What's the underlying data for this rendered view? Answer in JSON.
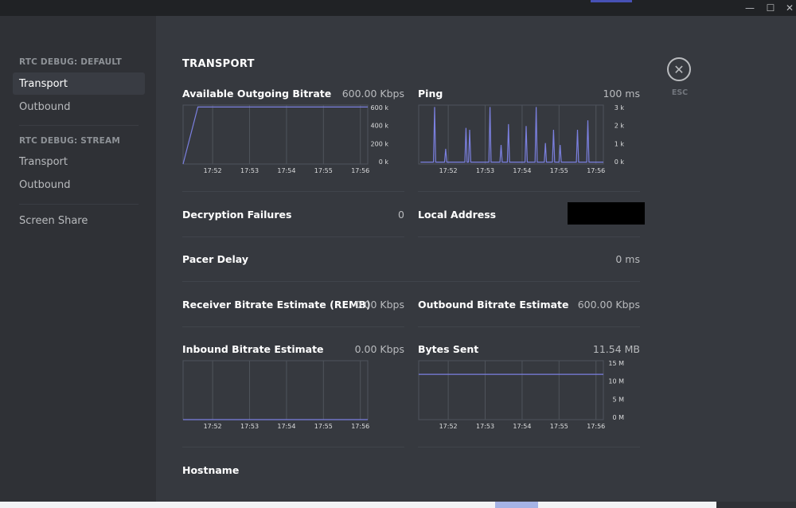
{
  "window_controls": {
    "minimize": "—",
    "maximize": "☐",
    "close": "✕"
  },
  "sidebar": {
    "sections": [
      {
        "header": "RTC DEBUG: DEFAULT",
        "items": [
          {
            "label": "Transport",
            "selected": true
          },
          {
            "label": "Outbound",
            "selected": false
          }
        ]
      },
      {
        "header": "RTC DEBUG: STREAM",
        "items": [
          {
            "label": "Transport",
            "selected": false
          },
          {
            "label": "Outbound",
            "selected": false
          }
        ]
      },
      {
        "header": "",
        "items": [
          {
            "label": "Screen Share",
            "selected": false
          }
        ]
      }
    ]
  },
  "main": {
    "title": "TRANSPORT",
    "close": {
      "icon": "close-icon",
      "glyph": "✕",
      "label": "ESC"
    },
    "metrics": {
      "available_outgoing_bitrate": {
        "label": "Available Outgoing Bitrate",
        "value": "600.00 Kbps"
      },
      "ping": {
        "label": "Ping",
        "value": "100 ms"
      },
      "decryption_failures": {
        "label": "Decryption Failures",
        "value": "0"
      },
      "local_address": {
        "label": "Local Address",
        "value": ""
      },
      "pacer_delay": {
        "label": "Pacer Delay",
        "value": "0 ms"
      },
      "receiver_bitrate_estimate": {
        "label": "Receiver Bitrate Estimate (REMB)",
        "value": "0.00 Kbps"
      },
      "outbound_bitrate_estimate": {
        "label": "Outbound Bitrate Estimate",
        "value": "600.00 Kbps"
      },
      "inbound_bitrate_estimate": {
        "label": "Inbound Bitrate Estimate",
        "value": "0.00 Kbps"
      },
      "bytes_sent": {
        "label": "Bytes Sent",
        "value": "11.54 MB"
      },
      "hostname": {
        "label": "Hostname",
        "value": ""
      }
    }
  },
  "chart_data": [
    {
      "type": "line",
      "x_ticks": [
        "17:52",
        "17:53",
        "17:54",
        "17:55",
        "17:56"
      ],
      "y_ticks": [
        "600 k",
        "400 k",
        "200 k",
        "0 k"
      ],
      "ylim": [
        0,
        620
      ],
      "x": [
        0,
        0.4,
        1,
        5
      ],
      "values": [
        0,
        600,
        600,
        600
      ]
    },
    {
      "type": "line",
      "x_ticks": [
        "17:52",
        "17:53",
        "17:54",
        "17:55",
        "17:56"
      ],
      "y_ticks": [
        "3 k",
        "2 k",
        "1 k",
        "0 k"
      ],
      "ylim": [
        0,
        3100
      ],
      "x": [
        0.05,
        0.1,
        0.4,
        0.43,
        0.46,
        0.7,
        0.73,
        0.76,
        1.25,
        1.28,
        1.31,
        1.35,
        1.38,
        1.41,
        1.9,
        1.93,
        1.96,
        2.2,
        2.23,
        2.26,
        2.4,
        2.43,
        2.46,
        2.88,
        2.91,
        2.94,
        3.15,
        3.18,
        3.21,
        3.4,
        3.43,
        3.46,
        3.62,
        3.65,
        3.68,
        3.8,
        3.83,
        3.86,
        4.27,
        4.3,
        4.33,
        4.55,
        4.58,
        4.61,
        5
      ],
      "values": [
        100,
        100,
        100,
        3000,
        100,
        100,
        800,
        100,
        100,
        1900,
        100,
        100,
        1800,
        100,
        100,
        3000,
        100,
        100,
        1000,
        100,
        100,
        2100,
        100,
        100,
        2000,
        100,
        100,
        3000,
        100,
        100,
        1100,
        100,
        100,
        1800,
        100,
        100,
        1000,
        100,
        100,
        1800,
        100,
        100,
        2300,
        100,
        100
      ]
    },
    {
      "type": "line",
      "x_ticks": [
        "17:52",
        "17:53",
        "17:54",
        "17:55",
        "17:56"
      ],
      "y_ticks": [],
      "ylim": [
        0,
        100
      ],
      "x": [
        0,
        5
      ],
      "values": [
        0,
        0
      ]
    },
    {
      "type": "line",
      "x_ticks": [
        "17:52",
        "17:53",
        "17:54",
        "17:55",
        "17:56"
      ],
      "y_ticks": [
        "15 M",
        "10 M",
        "5 M",
        "0 M"
      ],
      "ylim": [
        0,
        15
      ],
      "x": [
        0,
        5
      ],
      "values": [
        11.54,
        11.54
      ]
    }
  ]
}
